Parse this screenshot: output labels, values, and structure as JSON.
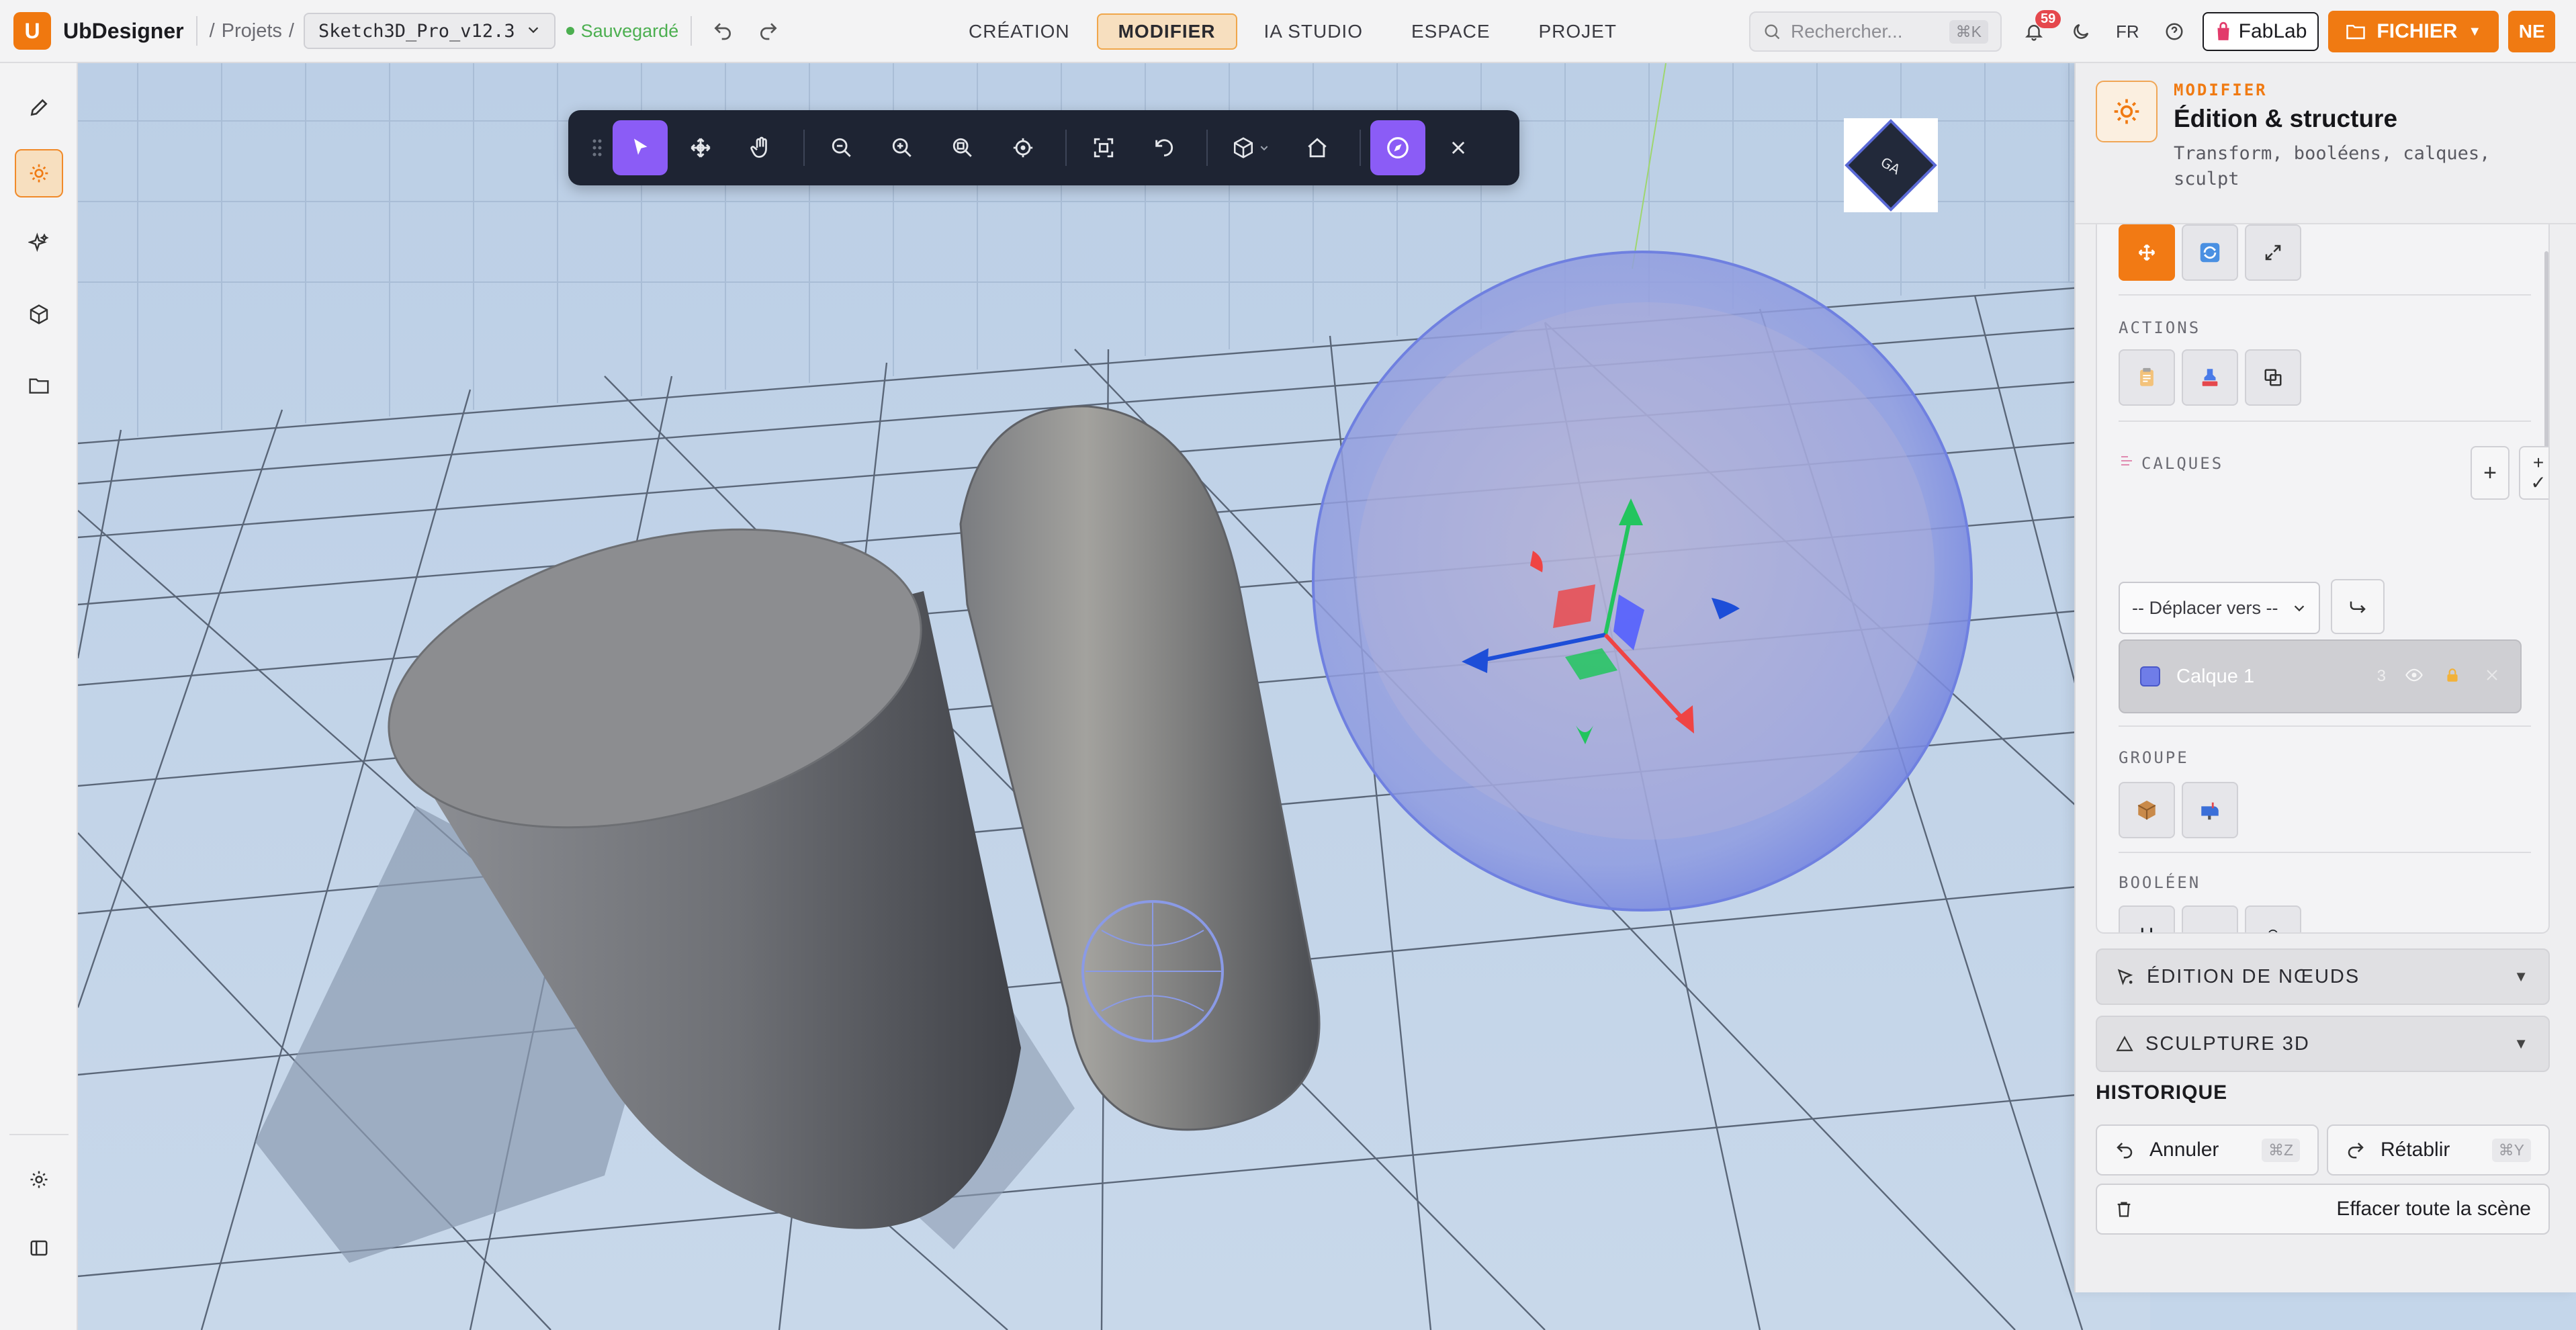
{
  "app": {
    "logo_letter": "U",
    "name": "UbDesigner"
  },
  "breadcrumb": {
    "separator": "/",
    "root": "Projets"
  },
  "project": {
    "name": "Sketch3D_Pro_v12.3",
    "status": "Sauvegardé"
  },
  "nav": {
    "tabs": [
      {
        "label": "CRÉATION",
        "active": false
      },
      {
        "label": "MODIFIER",
        "active": true
      },
      {
        "label": "IA STUDIO",
        "active": false
      },
      {
        "label": "ESPACE",
        "active": false
      },
      {
        "label": "PROJET",
        "active": false
      }
    ]
  },
  "search": {
    "placeholder": "Rechercher...",
    "shortcut": "⌘K"
  },
  "header_right": {
    "notifications": "59",
    "language": "FR",
    "fablab_label": "FabLab",
    "file_button": "FICHIER",
    "user_initials": "NE"
  },
  "navcube": {
    "face_label": "GA"
  },
  "panel": {
    "kicker": "MODIFIER",
    "title": "Édition & structure",
    "description": "Transform, booléens, calques, sculpt",
    "sections": {
      "actions": "ACTIONS",
      "layers": "CALQUES",
      "group": "GROUPE",
      "boolean": "BOOLÉEN"
    },
    "move_to_select": "-- Déplacer vers --",
    "layer": {
      "name": "Calque 1",
      "count": "3",
      "color": "#6f7de8"
    },
    "boolean_ops": [
      "∪",
      "−",
      "∩"
    ],
    "accordions": [
      {
        "label": "ÉDITION DE NŒUDS"
      },
      {
        "label": "SCULPTURE 3D"
      }
    ],
    "history": {
      "title": "HISTORIQUE",
      "undo_label": "Annuler",
      "undo_shortcut": "⌘Z",
      "redo_label": "Rétablir",
      "redo_shortcut": "⌘Y",
      "clear_label": "Effacer toute la scène"
    }
  },
  "colors": {
    "accent": "#f07a12",
    "viewport_bg": "#c4d6ea",
    "toolbar_bg": "#1e2433",
    "tool_active": "#8b5cf6",
    "sphere": "#7f93e6"
  }
}
